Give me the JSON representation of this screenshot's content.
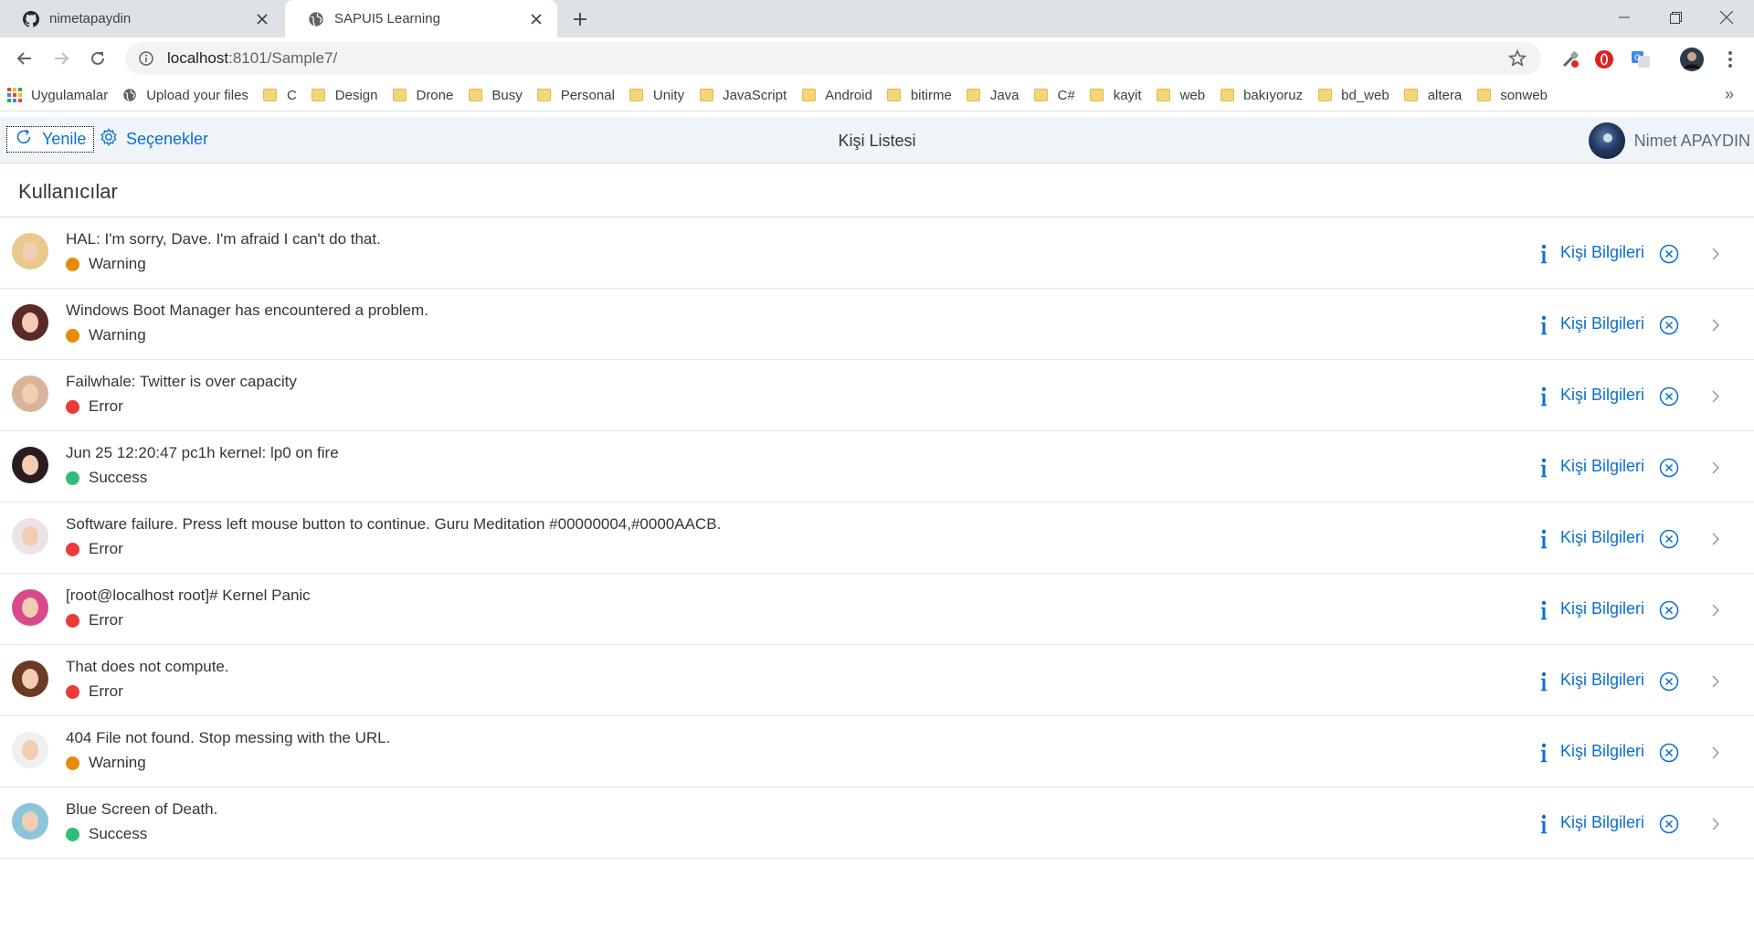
{
  "browser": {
    "tabs": [
      {
        "title": "nimetapaydin",
        "icon": "github-icon"
      },
      {
        "title": "SAPUI5 Learning",
        "icon": "globe-icon"
      }
    ],
    "url": {
      "host": "localhost",
      "path": ":8101/Sample7/"
    },
    "bookmarks": [
      {
        "label": "Uygulamalar",
        "icon": "apps-icon"
      },
      {
        "label": "Upload your files",
        "icon": "globe-icon"
      },
      {
        "label": "C",
        "icon": "folder-icon"
      },
      {
        "label": "Design",
        "icon": "folder-icon"
      },
      {
        "label": "Drone",
        "icon": "folder-icon"
      },
      {
        "label": "Busy",
        "icon": "folder-icon"
      },
      {
        "label": "Personal",
        "icon": "folder-icon"
      },
      {
        "label": "Unity",
        "icon": "folder-icon"
      },
      {
        "label": "JavaScript",
        "icon": "folder-icon"
      },
      {
        "label": "Android",
        "icon": "folder-icon"
      },
      {
        "label": "bitirme",
        "icon": "folder-icon"
      },
      {
        "label": "Java",
        "icon": "folder-icon"
      },
      {
        "label": "C#",
        "icon": "folder-icon"
      },
      {
        "label": "kayit",
        "icon": "folder-icon"
      },
      {
        "label": "web",
        "icon": "folder-icon"
      },
      {
        "label": "bakıyoruz",
        "icon": "folder-icon"
      },
      {
        "label": "bd_web",
        "icon": "folder-icon"
      },
      {
        "label": "altera",
        "icon": "folder-icon"
      },
      {
        "label": "sonweb",
        "icon": "folder-icon"
      }
    ],
    "bookmarks_more": "»"
  },
  "shell": {
    "refresh_label": "Yenile",
    "options_label": "Seçenekler",
    "title": "Kişi Listesi",
    "user_name": "Nimet APAYDIN"
  },
  "panel": {
    "title": "Kullanıcılar"
  },
  "status_colors": {
    "Warning": "#e78c07",
    "Error": "#ee3939",
    "Success": "#2fbe79"
  },
  "link_color": "#0a6ed1",
  "items": [
    {
      "title": "HAL: I'm sorry, Dave. I'm afraid I can't do that.",
      "status": "Warning",
      "link": "Kişi Bilgileri",
      "avatar_bg": "#e9c98c"
    },
    {
      "title": "Windows Boot Manager has encountered a problem.",
      "status": "Warning",
      "link": "Kişi Bilgileri",
      "avatar_bg": "#5a2a28"
    },
    {
      "title": "Failwhale: Twitter is over capacity",
      "status": "Error",
      "link": "Kişi Bilgileri",
      "avatar_bg": "#d9b49a"
    },
    {
      "title": "Jun 25 12:20:47 pc1h kernel: lp0 on fire",
      "status": "Success",
      "link": "Kişi Bilgileri",
      "avatar_bg": "#2a1d1f"
    },
    {
      "title": "Software failure. Press left mouse button to continue. Guru Meditation #00000004,#0000AACB.",
      "status": "Error",
      "link": "Kişi Bilgileri",
      "avatar_bg": "#ece3e6"
    },
    {
      "title": "[root@localhost root]# Kernel Panic",
      "status": "Error",
      "link": "Kişi Bilgileri",
      "avatar_bg": "#d94a8c"
    },
    {
      "title": "That does not compute.",
      "status": "Error",
      "link": "Kişi Bilgileri",
      "avatar_bg": "#6b3a24"
    },
    {
      "title": "404 File not found. Stop messing with the URL.",
      "status": "Warning",
      "link": "Kişi Bilgileri",
      "avatar_bg": "#efefef"
    },
    {
      "title": "Blue Screen of Death.",
      "status": "Success",
      "link": "Kişi Bilgileri",
      "avatar_bg": "#8cc4d9"
    }
  ]
}
